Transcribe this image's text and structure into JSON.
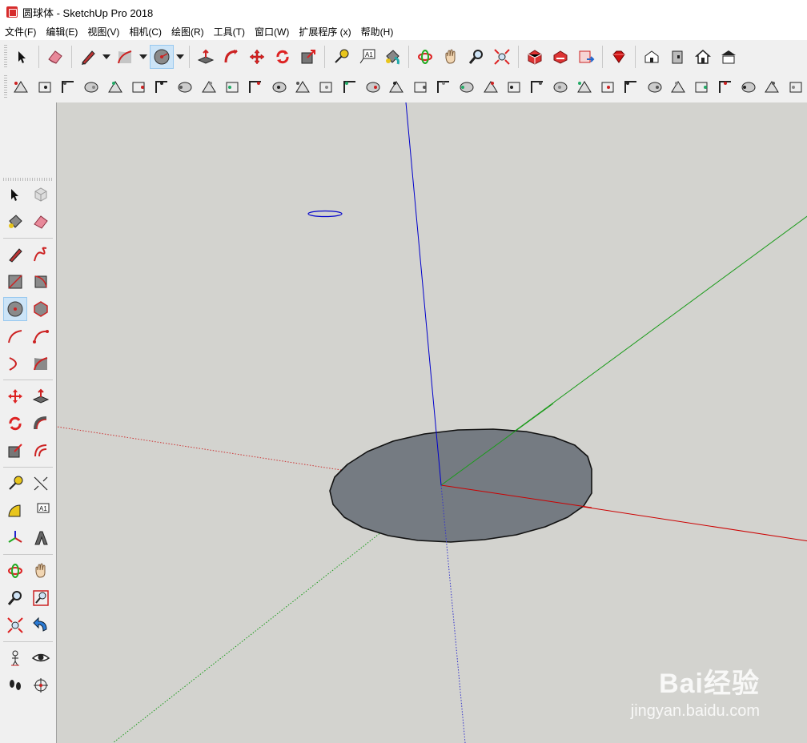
{
  "window": {
    "title": "圆球体 - SketchUp Pro 2018"
  },
  "menu": [
    "文件(F)",
    "编辑(E)",
    "视图(V)",
    "相机(C)",
    "绘图(R)",
    "工具(T)",
    "窗口(W)",
    "扩展程序 (x)",
    "帮助(H)"
  ],
  "toolbar_main": {
    "tools": [
      {
        "name": "select-tool",
        "icon": "arrow-cursor-icon"
      },
      {
        "name": "eraser-tool",
        "icon": "eraser-icon"
      },
      {
        "name": "line-tool",
        "icon": "pencil-icon"
      },
      {
        "name": "arc-tool",
        "icon": "arc-icon"
      },
      {
        "name": "circle-tool",
        "icon": "circle-icon",
        "active": true
      },
      {
        "name": "push-pull-tool",
        "icon": "push-pull-icon"
      },
      {
        "name": "follow-me-tool",
        "icon": "follow-me-icon"
      },
      {
        "name": "move-tool",
        "icon": "move-icon"
      },
      {
        "name": "rotate-tool",
        "icon": "rotate-icon"
      },
      {
        "name": "scale-tool",
        "icon": "scale-icon"
      },
      {
        "name": "tape-measure-tool",
        "icon": "tape-measure-icon"
      },
      {
        "name": "text-tool",
        "icon": "text-label-icon",
        "text": "A1"
      },
      {
        "name": "paint-bucket-tool",
        "icon": "paint-bucket-icon"
      },
      {
        "name": "orbit-tool",
        "icon": "orbit-icon"
      },
      {
        "name": "pan-tool",
        "icon": "hand-icon"
      },
      {
        "name": "zoom-tool",
        "icon": "magnifier-icon"
      },
      {
        "name": "zoom-extents-tool",
        "icon": "zoom-extents-icon"
      },
      {
        "name": "warehouse-tool",
        "icon": "3d-warehouse-icon"
      },
      {
        "name": "share-model-tool",
        "icon": "share-model-icon"
      },
      {
        "name": "extension-warehouse-tool",
        "icon": "extension-warehouse-icon"
      },
      {
        "name": "ruby-console-tool",
        "icon": "ruby-icon"
      },
      {
        "name": "iso-view",
        "icon": "house-iso-icon"
      },
      {
        "name": "right-view",
        "icon": "house-right-icon"
      },
      {
        "name": "front-view",
        "icon": "house-front-icon"
      },
      {
        "name": "top-view",
        "icon": "house-top-icon"
      }
    ]
  },
  "toolbar_secondary_count": 34,
  "viewport": {
    "background": "#d3d3cf",
    "axis_colors": {
      "x": "#cc0000",
      "y": "#1a9b1a",
      "z": "#0000cc"
    },
    "face_color": "#757b82"
  },
  "watermark": {
    "logo": "Bai经验",
    "url": "jingyan.baidu.com"
  }
}
